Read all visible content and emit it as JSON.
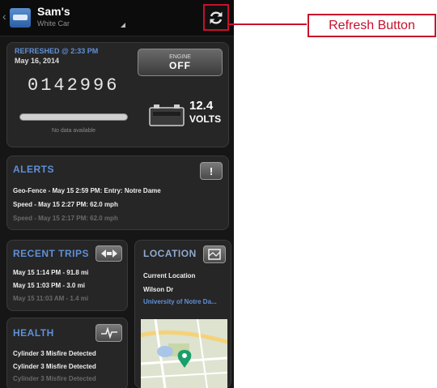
{
  "header": {
    "title": "Sam's",
    "subtitle": "White Car"
  },
  "status": {
    "refreshed_label": "REFRESHED @ 2:33 PM",
    "refreshed_date": "May 16, 2014",
    "odometer": "0142996",
    "engine_button": {
      "top": "ENGINE",
      "value": "OFF"
    },
    "fuel_note": "No data available",
    "volts_value": "12.4",
    "volts_unit": "VOLTS"
  },
  "alerts": {
    "title": "ALERTS",
    "button_glyph": "!",
    "items": [
      "Geo-Fence - May 15 2:59 PM: Entry: Notre Dame",
      "Speed - May 15 2:27 PM: 62.0 mph",
      "Speed - May 15 2:17 PM: 62.0 mph"
    ]
  },
  "recent_trips": {
    "title": "RECENT TRIPS",
    "items": [
      "May 15 1:14 PM - 91.8 mi",
      "May 15 1:03 PM - 3.0 mi",
      "May 15 11:03 AM - 1.4 mi"
    ]
  },
  "location": {
    "title": "LOCATION",
    "label": "Current Location",
    "street": "Wilson Dr",
    "place": "University of Notre Da..."
  },
  "health": {
    "title": "HEALTH",
    "items": [
      "Cylinder 3 Misfire Detected",
      "Cylinder 3 Misfire Detected",
      "Cylinder 3 Misfire Detected"
    ]
  },
  "annotation": {
    "label": "Refresh Button"
  },
  "icons": {
    "refresh": "refresh-icon",
    "battery": "battery-icon",
    "alert": "exclamation-icon",
    "trips": "arrows-icon",
    "location": "map-icon",
    "health": "heartbeat-icon",
    "map_pin": "map-pin-icon"
  },
  "colors": {
    "accent_blue": "#5f90d8",
    "annotation_red": "#c8102e",
    "map_pin": "#1a9e6a"
  }
}
